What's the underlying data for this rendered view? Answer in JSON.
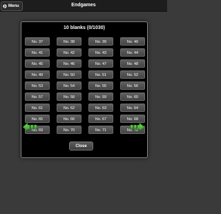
{
  "topbar": {
    "menu_label": "Menu",
    "title": "Endgames"
  },
  "dialog": {
    "title": "10 blanks (0/1030)",
    "items": [
      "No. 37",
      "No. 38",
      "No. 39",
      "No. 40",
      "No. 41",
      "No. 42",
      "No. 43",
      "No. 44",
      "No. 45",
      "No. 46",
      "No. 47",
      "No. 48",
      "No. 49",
      "No. 50",
      "No. 51",
      "No. 52",
      "No. 53",
      "No. 54",
      "No. 55",
      "No. 56",
      "No. 57",
      "No. 58",
      "No. 59",
      "No. 60",
      "No. 61",
      "No. 62",
      "No. 63",
      "No. 64",
      "No. 65",
      "No. 66",
      "No. 67",
      "No. 68",
      "No. 69",
      "No. 70",
      "No. 71",
      "No. 72"
    ],
    "close_label": "Close",
    "prev_icon": "left-arrow-icon",
    "next_icon": "right-arrow-icon"
  },
  "colors": {
    "background": "#3a3a3a",
    "dialog_bg": "#000000",
    "button_bg": "#555555",
    "arrow_green": "#3fbf2f"
  }
}
